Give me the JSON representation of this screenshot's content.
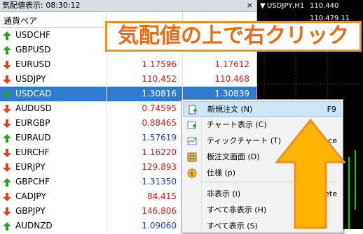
{
  "window": {
    "title": "気配値表示: 08:30:12",
    "close": "×"
  },
  "header": {
    "symbol_col": "通貨ペア"
  },
  "rows": [
    {
      "symbol": "USDCHF",
      "bid": "",
      "ask": "",
      "dir": "up",
      "bidc": "",
      "askc": ""
    },
    {
      "symbol": "GBPUSD",
      "bid": "",
      "ask": "",
      "dir": "up",
      "bidc": "",
      "askc": ""
    },
    {
      "symbol": "EURUSD",
      "bid": "1.17596",
      "ask": "1.17612",
      "dir": "down",
      "bidc": "#e11a1a",
      "askc": "#e11a1a"
    },
    {
      "symbol": "USDJPY",
      "bid": "110.452",
      "ask": "110.468",
      "dir": "down",
      "bidc": "#e11a1a",
      "askc": "#e11a1a"
    },
    {
      "symbol": "USDCAD",
      "bid": "1.30816",
      "ask": "1.30839",
      "dir": "up",
      "bidc": "#ffffff",
      "askc": "#ffffff",
      "selected": true
    },
    {
      "symbol": "AUDUSD",
      "bid": "0.74595",
      "ask": "",
      "dir": "down",
      "bidc": "#e11a1a",
      "askc": ""
    },
    {
      "symbol": "EURGBP",
      "bid": "0.88465",
      "ask": "",
      "dir": "down",
      "bidc": "#e11a1a",
      "askc": ""
    },
    {
      "symbol": "EURAUD",
      "bid": "1.57619",
      "ask": "",
      "dir": "up",
      "bidc": "#1f3ed8",
      "askc": ""
    },
    {
      "symbol": "EURCHF",
      "bid": "1.16220",
      "ask": "",
      "dir": "down",
      "bidc": "#e11a1a",
      "askc": ""
    },
    {
      "symbol": "EURJPY",
      "bid": "129.893",
      "ask": "",
      "dir": "down",
      "bidc": "#e11a1a",
      "askc": ""
    },
    {
      "symbol": "GBPCHF",
      "bid": "1.31350",
      "ask": "",
      "dir": "up",
      "bidc": "#1f3ed8",
      "askc": ""
    },
    {
      "symbol": "CADJPY",
      "bid": "84.415",
      "ask": "",
      "dir": "down",
      "bidc": "#e11a1a",
      "askc": ""
    },
    {
      "symbol": "GBPJPY",
      "bid": "146.806",
      "ask": "",
      "dir": "down",
      "bidc": "#e11a1a",
      "askc": ""
    },
    {
      "symbol": "AUDNZD",
      "bid": "1.09060",
      "ask": "",
      "dir": "up",
      "bidc": "#1f3ed8",
      "askc": ""
    }
  ],
  "chart": {
    "arrow": "▼",
    "name": "USDJPY,H1",
    "prices": "110.440 110.479 11"
  },
  "banner": {
    "text": "気配値の上で右クリック"
  },
  "menu": {
    "items": [
      {
        "label": "新規注文 (N)",
        "shortcut": "F9",
        "icon": "new-order-icon",
        "highlight": true
      },
      {
        "label": "チャート表示 (C)",
        "shortcut": "",
        "icon": "chart-window-icon"
      },
      {
        "label": "ティックチャート (T)",
        "shortcut": "nace",
        "icon": "tick-chart-icon"
      },
      {
        "label": "板注文画面 (D)",
        "shortcut": "B",
        "icon": "depth-of-market-icon"
      },
      {
        "label": "仕様 (p)",
        "shortcut": "",
        "icon": "specification-icon"
      },
      {
        "label": "非表示 (i)",
        "shortcut": "ete",
        "icon": ""
      },
      {
        "label": "すべて非表示 (H)",
        "shortcut": "",
        "icon": ""
      },
      {
        "label": "すべて表示 (S)",
        "shortcut": "",
        "icon": ""
      }
    ]
  },
  "colors": {
    "accent_orange": "#f08f1e",
    "arrow_yellow": "#ffb400",
    "selection": "#2f7bd4"
  }
}
